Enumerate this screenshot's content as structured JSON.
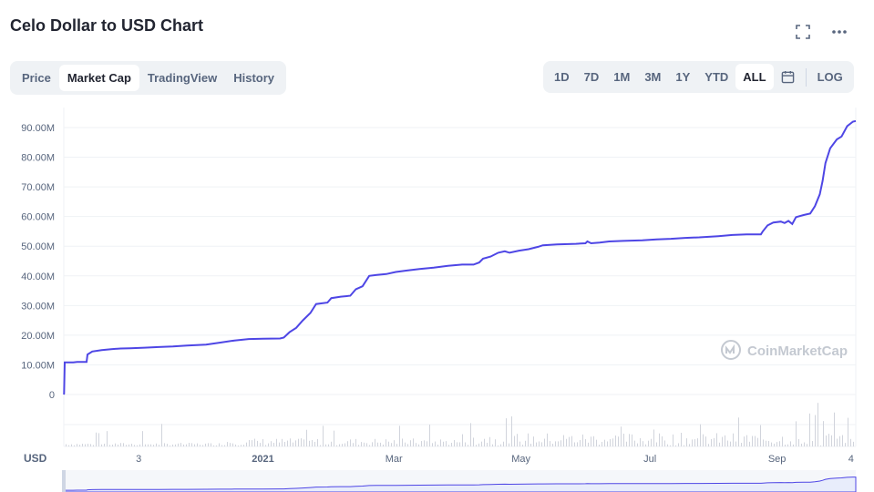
{
  "header": {
    "title": "Celo Dollar to USD Chart"
  },
  "tabs": [
    {
      "label": "Price",
      "active": false
    },
    {
      "label": "Market Cap",
      "active": true
    },
    {
      "label": "TradingView",
      "active": false
    },
    {
      "label": "History",
      "active": false
    }
  ],
  "ranges": [
    {
      "label": "1D",
      "active": false
    },
    {
      "label": "7D",
      "active": false
    },
    {
      "label": "1M",
      "active": false
    },
    {
      "label": "3M",
      "active": false
    },
    {
      "label": "1Y",
      "active": false
    },
    {
      "label": "YTD",
      "active": false
    },
    {
      "label": "ALL",
      "active": true
    }
  ],
  "log_label": "LOG",
  "icons": {
    "fullscreen": "fullscreen-icon",
    "more": "more-options-icon",
    "calendar": "calendar-icon",
    "watermark": "coinmarketcap-logo-icon"
  },
  "watermark_text": "CoinMarketCap",
  "currency_label": "USD",
  "colors": {
    "line": "#4e46e5",
    "volume": "#d1d4dc",
    "grid": "#eff2f5",
    "navigator_fill": "#e8edfb"
  },
  "chart_data": {
    "type": "line",
    "title": "Celo Dollar to USD Chart",
    "series": [
      {
        "values": [
          [
            0,
            0
          ],
          [
            0.3,
            0.3
          ],
          [
            1,
            10.8
          ],
          [
            10,
            10.8
          ],
          [
            14,
            11.0
          ],
          [
            24,
            11.0
          ],
          [
            25,
            13.5
          ],
          [
            30,
            14.5
          ],
          [
            40,
            15.0
          ],
          [
            50,
            15.3
          ],
          [
            60,
            15.5
          ],
          [
            70,
            15.6
          ],
          [
            85,
            15.8
          ],
          [
            100,
            16.0
          ],
          [
            115,
            16.2
          ],
          [
            130,
            16.5
          ],
          [
            150,
            16.8
          ],
          [
            165,
            17.5
          ],
          [
            180,
            18.2
          ],
          [
            195,
            18.7
          ],
          [
            210,
            18.8
          ],
          [
            228,
            18.9
          ],
          [
            232,
            19.2
          ],
          [
            238,
            21.0
          ],
          [
            245,
            22.5
          ],
          [
            252,
            25.0
          ],
          [
            260,
            27.5
          ],
          [
            266,
            30.5
          ],
          [
            278,
            31.0
          ],
          [
            282,
            32.5
          ],
          [
            292,
            33.0
          ],
          [
            302,
            33.3
          ],
          [
            308,
            35.5
          ],
          [
            315,
            36.5
          ],
          [
            322,
            40.0
          ],
          [
            330,
            40.3
          ],
          [
            340,
            40.6
          ],
          [
            350,
            41.3
          ],
          [
            362,
            41.8
          ],
          [
            375,
            42.3
          ],
          [
            390,
            42.8
          ],
          [
            405,
            43.4
          ],
          [
            420,
            43.8
          ],
          [
            432,
            43.8
          ],
          [
            438,
            44.5
          ],
          [
            442,
            45.8
          ],
          [
            450,
            46.5
          ],
          [
            458,
            47.8
          ],
          [
            465,
            48.3
          ],
          [
            470,
            47.8
          ],
          [
            480,
            48.5
          ],
          [
            490,
            49.0
          ],
          [
            500,
            49.8
          ],
          [
            505,
            50.3
          ],
          [
            520,
            50.6
          ],
          [
            540,
            50.8
          ],
          [
            550,
            51.0
          ],
          [
            552,
            51.6
          ],
          [
            556,
            51.0
          ],
          [
            565,
            51.2
          ],
          [
            575,
            51.6
          ],
          [
            590,
            51.8
          ],
          [
            610,
            52.0
          ],
          [
            625,
            52.3
          ],
          [
            640,
            52.5
          ],
          [
            655,
            52.8
          ],
          [
            670,
            53.0
          ],
          [
            690,
            53.4
          ],
          [
            705,
            53.8
          ],
          [
            720,
            54.0
          ],
          [
            735,
            54.0
          ],
          [
            737,
            55.0
          ],
          [
            742,
            57.0
          ],
          [
            748,
            58.0
          ],
          [
            756,
            58.3
          ],
          [
            760,
            57.8
          ],
          [
            764,
            58.5
          ],
          [
            768,
            57.5
          ],
          [
            772,
            59.8
          ],
          [
            780,
            60.5
          ],
          [
            787,
            61.0
          ],
          [
            792,
            63.5
          ],
          [
            797,
            67.5
          ],
          [
            800,
            72.0
          ],
          [
            803,
            78.0
          ],
          [
            808,
            83.0
          ],
          [
            815,
            86.0
          ],
          [
            820,
            87.0
          ],
          [
            826,
            90.5
          ],
          [
            832,
            92.0
          ],
          [
            835,
            92.2
          ]
        ]
      }
    ],
    "y_ticks": [
      "90.00M",
      "80.00M",
      "70.00M",
      "60.00M",
      "50.00M",
      "40.00M",
      "30.00M",
      "20.00M",
      "10.00M",
      "0"
    ],
    "ylim": [
      0,
      90
    ],
    "x_ticks": [
      {
        "label": "3",
        "day": 79,
        "bold": false
      },
      {
        "label": "2021",
        "day": 210,
        "bold": true
      },
      {
        "label": "Mar",
        "day": 348,
        "bold": false
      },
      {
        "label": "May",
        "day": 482,
        "bold": false
      },
      {
        "label": "Jul",
        "day": 618,
        "bold": false
      },
      {
        "label": "Sep",
        "day": 752,
        "bold": false
      },
      {
        "label": "4",
        "day": 830,
        "bold": false
      }
    ],
    "xlim": [
      0,
      835
    ],
    "grid": true
  }
}
